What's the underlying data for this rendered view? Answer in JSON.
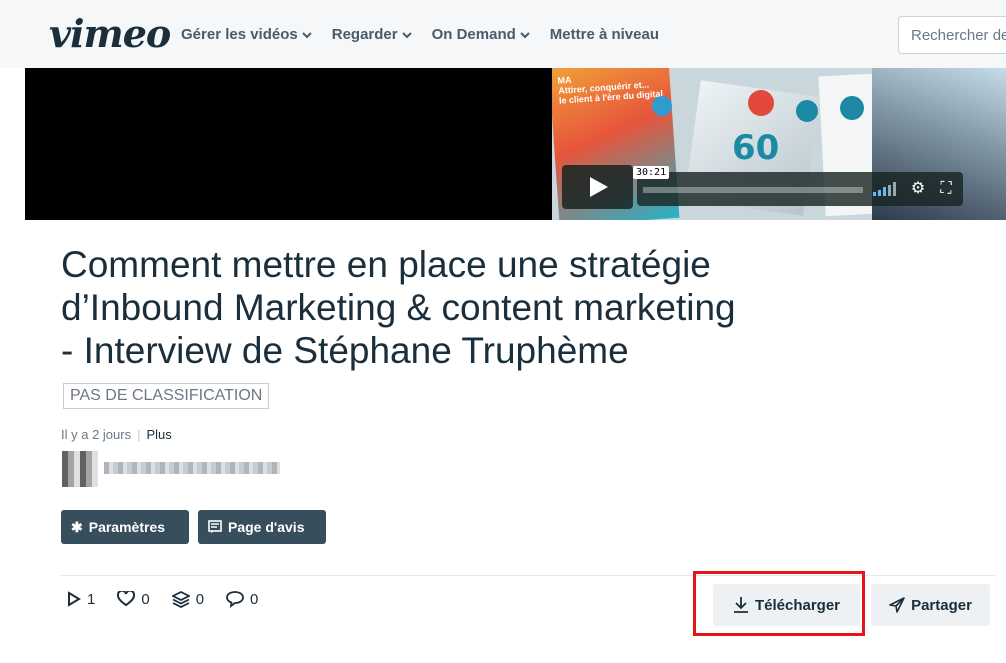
{
  "header": {
    "logo": "vimeo",
    "nav": [
      {
        "label": "Gérer les vidéos",
        "has_menu": true
      },
      {
        "label": "Regarder",
        "has_menu": true
      },
      {
        "label": "On Demand",
        "has_menu": true
      },
      {
        "label": "Mettre à niveau",
        "has_menu": false
      }
    ],
    "search_placeholder": "Rechercher de"
  },
  "player": {
    "timecode": "30:21",
    "book_text": "MA\nAttirer, conquérir et...\nle client à l'ère du digital",
    "cube_text": "60"
  },
  "video": {
    "title_lines": [
      "Comment mettre en place une stratégie",
      "d’Inbound Marketing & content marketing",
      "- Interview de Stéphane Truphème"
    ],
    "rating_badge": "PAS DE CLASSIFICATION",
    "age": "Il y a 2 jours",
    "more": "Plus"
  },
  "actions": {
    "settings": "Paramètres",
    "review_page": "Page d'avis",
    "download": "Télécharger",
    "share": "Partager"
  },
  "stats": {
    "plays": "1",
    "likes": "0",
    "collections": "0",
    "comments": "0"
  },
  "colors": {
    "highlight": "#e6141b",
    "dark_button": "#374e5d",
    "accent_volume": "#63b8ff"
  }
}
